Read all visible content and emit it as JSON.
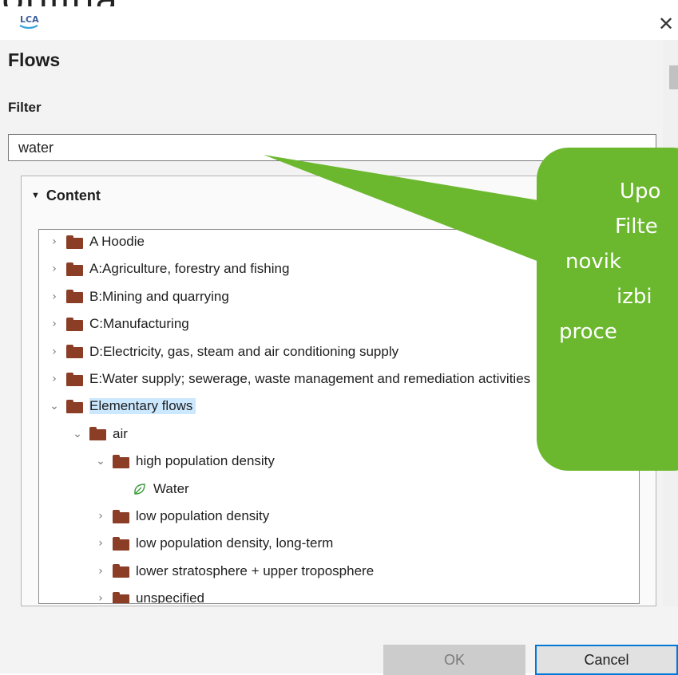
{
  "background_text": "onlina",
  "dialog": {
    "app_icon_text": "LCA",
    "close_symbol": "✕",
    "heading": "Flows",
    "filter_label": "Filter",
    "filter_value": "water",
    "section_title": "Content",
    "accent_color": "#0078d7",
    "callout_color": "#6bb82e"
  },
  "tree": [
    {
      "label": "A Hoodie",
      "expanded": false,
      "icon": "folder-icon"
    },
    {
      "label": "A:Agriculture, forestry and fishing",
      "expanded": false,
      "icon": "folder-icon"
    },
    {
      "label": "B:Mining and quarrying",
      "expanded": false,
      "icon": "folder-icon"
    },
    {
      "label": "C:Manufacturing",
      "expanded": false,
      "icon": "folder-icon"
    },
    {
      "label": "D:Electricity, gas, steam and air conditioning supply",
      "expanded": false,
      "icon": "folder-icon"
    },
    {
      "label": "E:Water supply; sewerage, waste management and remediation activities",
      "expanded": false,
      "icon": "folder-icon"
    },
    {
      "label": "Elementary flows",
      "expanded": true,
      "selected": true,
      "icon": "folder-icon"
    },
    {
      "label": "air",
      "expanded": true,
      "icon": "folder-icon"
    },
    {
      "label": "high population density",
      "expanded": true,
      "icon": "folder-icon"
    },
    {
      "label": "Water",
      "icon": "leaf-icon"
    },
    {
      "label": "low population density",
      "expanded": false,
      "icon": "folder-icon"
    },
    {
      "label": "low population density, long-term",
      "expanded": false,
      "icon": "folder-icon"
    },
    {
      "label": "lower stratosphere + upper troposphere",
      "expanded": false,
      "icon": "folder-icon"
    },
    {
      "label": "unspecified",
      "expanded": false,
      "icon": "folder-icon"
    }
  ],
  "callout": {
    "lines": [
      "Upo",
      "Filte",
      "novik",
      "izbi",
      "proce"
    ]
  },
  "buttons": {
    "ok": "OK",
    "cancel": "Cancel"
  }
}
